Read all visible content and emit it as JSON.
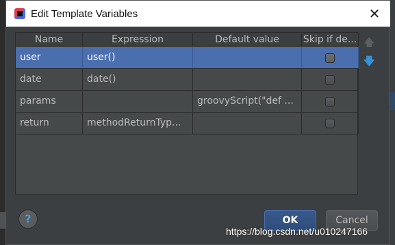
{
  "dialog": {
    "title": "Edit Template Variables",
    "close_glyph": "✕"
  },
  "table": {
    "headers": [
      "Name",
      "Expression",
      "Default value",
      "Skip if de..."
    ],
    "rows": [
      {
        "name": "user",
        "expression": "user()",
        "default_value": "",
        "skip": false,
        "selected": true
      },
      {
        "name": "date",
        "expression": "date()",
        "default_value": "",
        "skip": false,
        "selected": false
      },
      {
        "name": "params",
        "expression": "",
        "default_value": "groovyScript(\"def ...",
        "skip": false,
        "selected": false
      },
      {
        "name": "return",
        "expression": "methodReturnTyp...",
        "default_value": "",
        "skip": false,
        "selected": false
      }
    ]
  },
  "toolbar": {
    "move_up_icon": "arrow-up-icon",
    "move_down_icon": "arrow-down-icon",
    "move_up_glyph": "🡅",
    "move_down_glyph": "🡇"
  },
  "buttons": {
    "help_label": "?",
    "ok_label": "OK",
    "cancel_label": "Cancel"
  },
  "watermark": "https://blog.csdn.net/u010247166",
  "colors": {
    "selection": "#4b6eaf",
    "accent_blue": "#3592d8",
    "ok_button": "#2f4e7c"
  }
}
